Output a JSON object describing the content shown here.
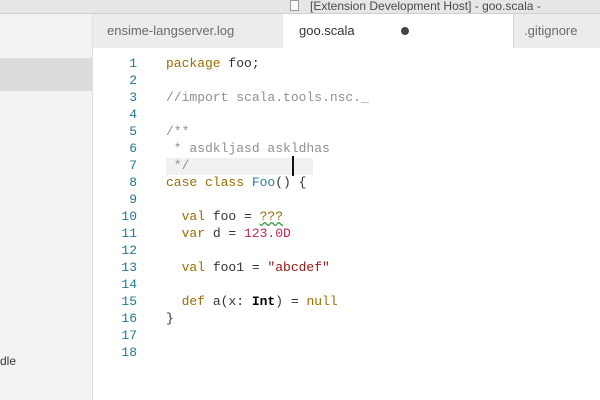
{
  "window": {
    "title": "[Extension Development Host] - goo.scala -"
  },
  "sidebar": {
    "fragment": "dle"
  },
  "tabs": [
    {
      "label": "ensime-langserver.log",
      "active": false
    },
    {
      "label": "goo.scala",
      "active": true,
      "modified": true
    },
    {
      "label": ".gitignore",
      "active": false
    }
  ],
  "editor": {
    "lines": [
      {
        "n": "1",
        "tokens": [
          [
            "kw",
            "package"
          ],
          [
            "plain",
            " foo;"
          ]
        ]
      },
      {
        "n": "2",
        "tokens": []
      },
      {
        "n": "3",
        "tokens": [
          [
            "cm",
            "//import scala.tools.nsc._"
          ]
        ]
      },
      {
        "n": "4",
        "tokens": []
      },
      {
        "n": "5",
        "tokens": [
          [
            "cm",
            "/**"
          ]
        ]
      },
      {
        "n": "6",
        "tokens": [
          [
            "cm",
            " * asdkljasd askldhas"
          ]
        ]
      },
      {
        "n": "7",
        "tokens": [
          [
            "cm",
            " */"
          ]
        ]
      },
      {
        "n": "8",
        "tokens": [
          [
            "kw",
            "case class "
          ],
          [
            "cls",
            "Foo"
          ],
          [
            "plain",
            "() {"
          ]
        ]
      },
      {
        "n": "9",
        "tokens": []
      },
      {
        "n": "10",
        "tokens": [
          [
            "kw",
            "  val "
          ],
          [
            "plain",
            "foo = "
          ],
          [
            "squig",
            "???"
          ]
        ]
      },
      {
        "n": "11",
        "tokens": [
          [
            "kw",
            "  var "
          ],
          [
            "plain",
            "d = "
          ],
          [
            "num",
            "123.0D"
          ]
        ]
      },
      {
        "n": "12",
        "tokens": []
      },
      {
        "n": "13",
        "tokens": [
          [
            "kw",
            "  val "
          ],
          [
            "plain",
            "foo1 = "
          ],
          [
            "str",
            "\"abcdef\""
          ]
        ]
      },
      {
        "n": "14",
        "tokens": []
      },
      {
        "n": "15",
        "tokens": [
          [
            "kw",
            "  def "
          ],
          [
            "plain",
            "a(x: "
          ],
          [
            "typ",
            "Int"
          ],
          [
            "plain",
            ") = "
          ],
          [
            "kw",
            "null"
          ]
        ]
      },
      {
        "n": "16",
        "tokens": [
          [
            "plain",
            "}"
          ]
        ]
      },
      {
        "n": "17",
        "tokens": []
      },
      {
        "n": "18",
        "tokens": []
      }
    ]
  }
}
